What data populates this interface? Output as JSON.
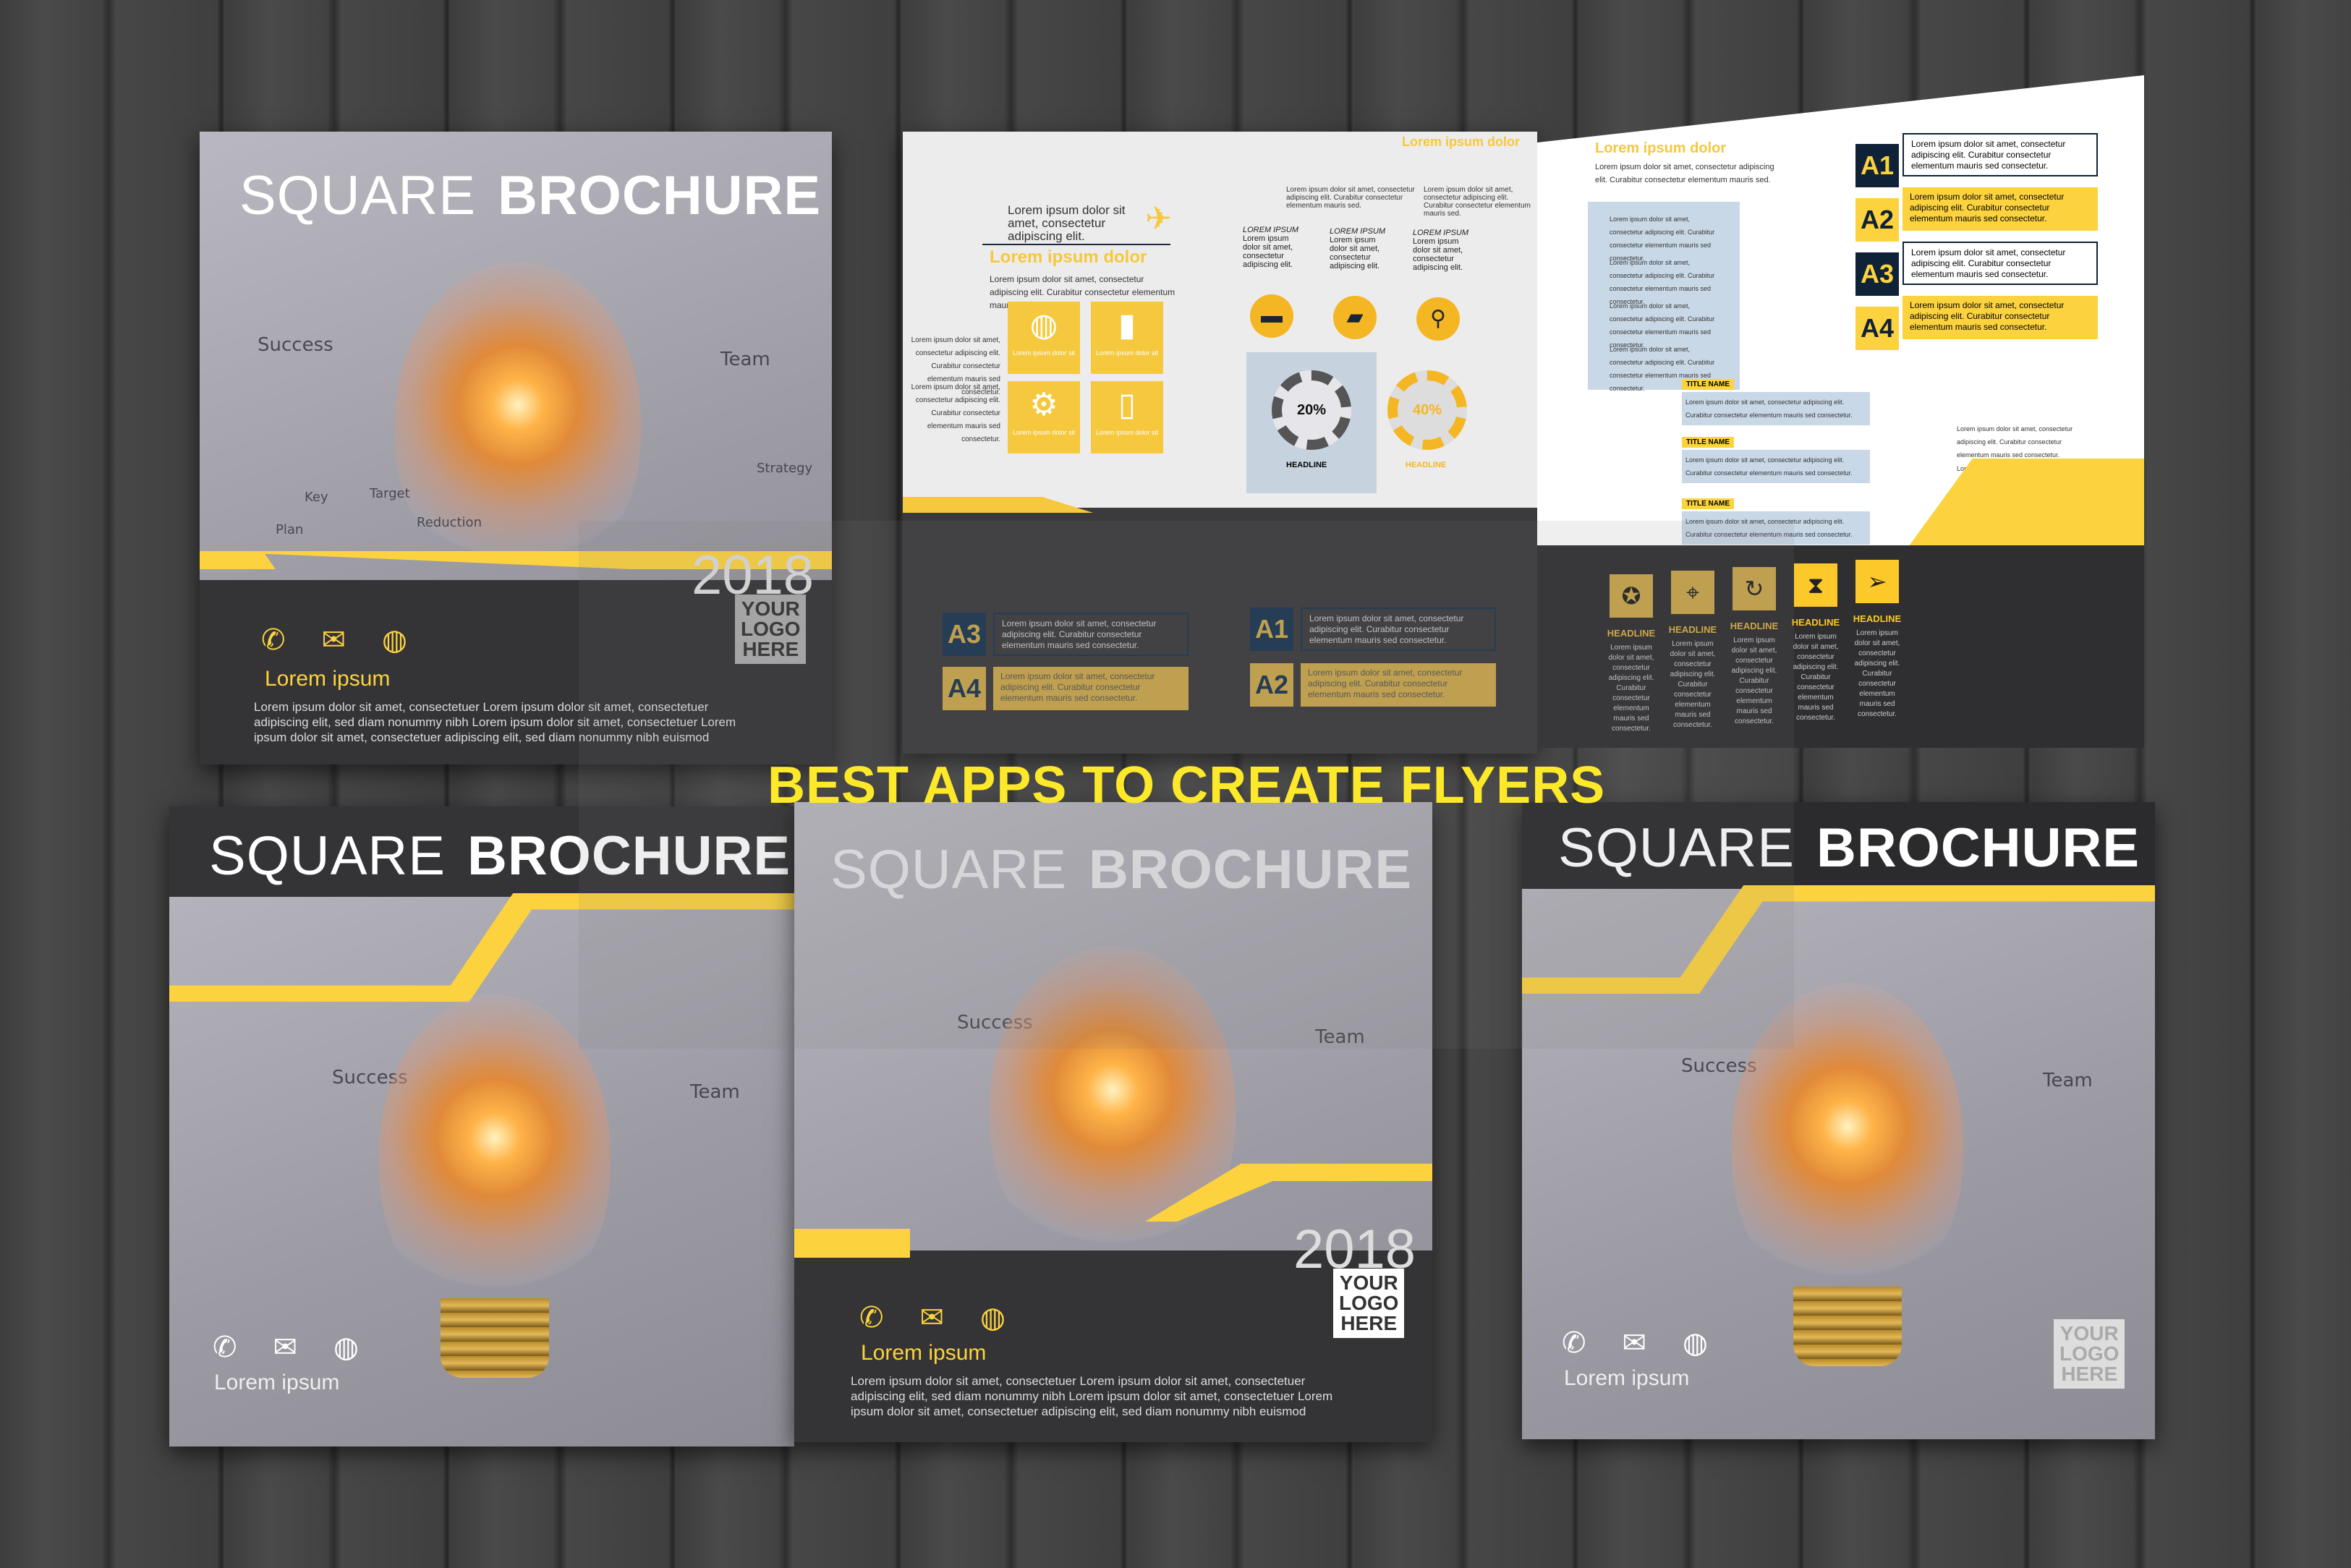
{
  "headline": "BEST APPS TO CREATE FLYERS",
  "cover": {
    "title_thin": "SQUARE",
    "title_bold": "BROCHURE",
    "year": "2018",
    "logo": [
      "YOUR",
      "LOGO",
      "HERE"
    ],
    "contact_title": "Lorem ipsum",
    "body": "Lorem ipsum dolor sit amet, consectetuer Lorem ipsum dolor sit amet, consectetuer adipiscing elit, sed diam nonummy nibh Lorem ipsum dolor sit amet, consectetuer Lorem ipsum dolor sit amet, consectetuer adipiscing elit, sed diam nonummy nibh euismod",
    "sketch_words": [
      "Success",
      "Team",
      "Plan",
      "Target",
      "Key",
      "Strategy",
      "Reduction"
    ],
    "icons": [
      "phone-icon",
      "envelope-icon",
      "globe-icon"
    ]
  },
  "spread": {
    "heading": "Lorem ipsum dolor",
    "plane_text": "Lorem ipsum dolor sit amet, consectetur adipiscing elit.",
    "intro": "Lorem ipsum dolor sit amet, consectetur adipiscing elit. Curabitur consectetur elementum mauris sed.",
    "side_text": "Lorem ipsum dolor sit amet, consectetur adipiscing elit. Curabitur consectetur elementum mauris sed consectetur.",
    "tile_label": "Lorem ipsum dolor sit",
    "col_title": "LOREM IPSUM",
    "col_text": "Lorem ipsum dolor sit amet, consectetur adipiscing elit.",
    "gauges": [
      {
        "value": "20%",
        "label": "HEADLINE"
      },
      {
        "value": "40%",
        "label": "HEADLINE"
      }
    ],
    "gauge_text": "Lorem ipsum dolor sit amet, consectetur adipiscing elit.",
    "list_text": "Lorem ipsum dolor sit amet, consectetur adipiscing elit. Curabitur consectetur elementum mauris sed consectetur.",
    "title_name": "TITLE NAME",
    "ribbon_text": "Lorem ipsum dolor sit amet, consectetur adipiscing elit. Curabitur consectetur elementum mauris sed consectetur.",
    "a_items": [
      "A1",
      "A2",
      "A3",
      "A4"
    ],
    "a_text": "Lorem ipsum dolor sit amet, consectetur adipiscing elit. Curabitur consectetur elementum mauris sed consectetur.",
    "headline_cols": [
      "HEADLINE",
      "HEADLINE",
      "HEADLINE",
      "HEADLINE",
      "HEADLINE"
    ],
    "headline_text": "Lorem ipsum dolor sit amet, consectetur adipiscing elit. Curabitur consectetur elementum mauris sed consectetur.",
    "headline_icons": [
      "badge-check-icon",
      "map-pin-icon",
      "refresh-icon",
      "hourglass-icon",
      "paper-plane-icon"
    ]
  },
  "colors": {
    "accent": "#fcd33f",
    "dark": "#343336",
    "navy": "#0f2238",
    "headline": "#fde92a"
  }
}
